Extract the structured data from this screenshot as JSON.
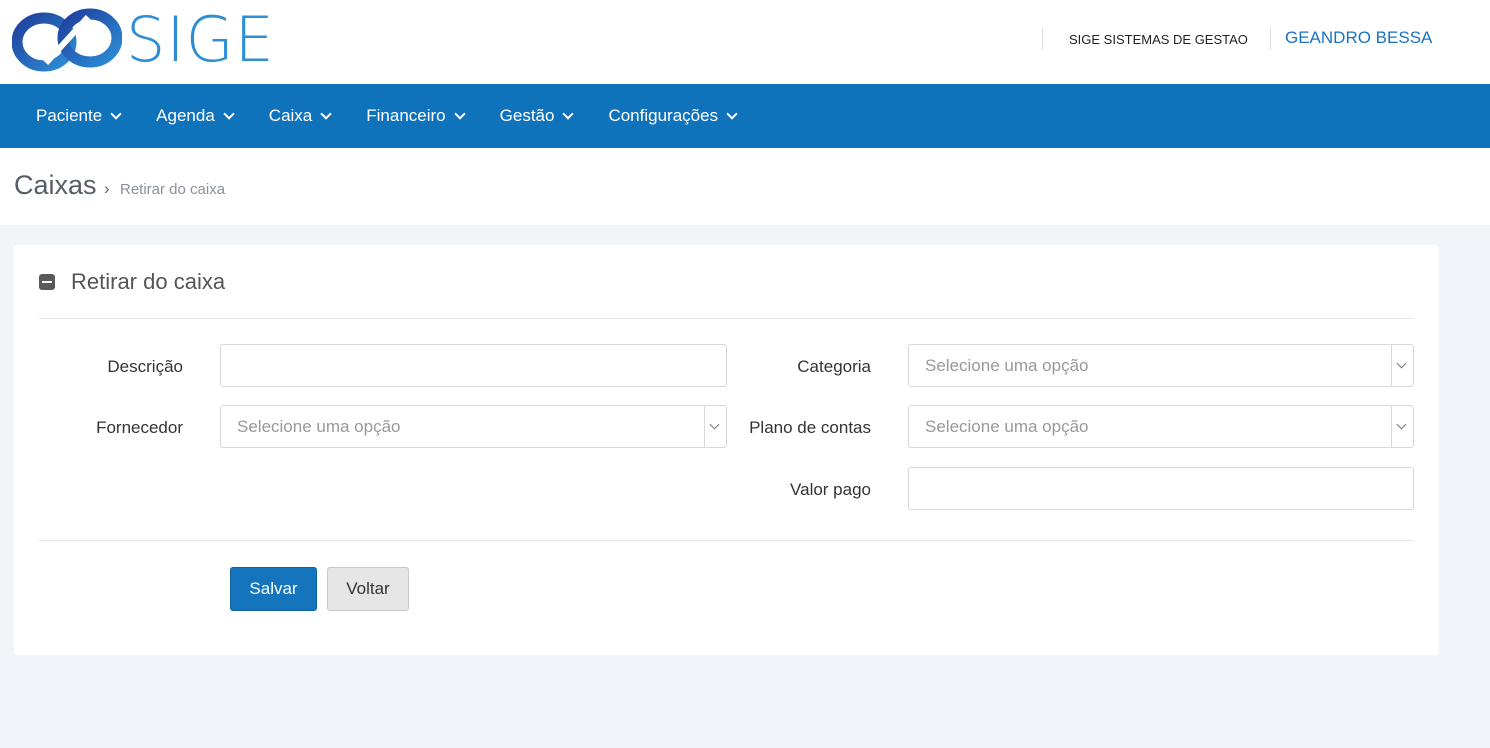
{
  "header": {
    "logo_text": "SIGE",
    "company": "SIGE SISTEMAS DE GESTAO",
    "user": "GEANDRO BESSA"
  },
  "nav": {
    "items": [
      {
        "label": "Paciente"
      },
      {
        "label": "Agenda"
      },
      {
        "label": "Caixa"
      },
      {
        "label": "Financeiro"
      },
      {
        "label": "Gestão"
      },
      {
        "label": "Configurações"
      }
    ]
  },
  "breadcrumb": {
    "title": "Caixas",
    "separator": "›",
    "current": "Retirar do caixa"
  },
  "panel": {
    "title": "Retirar do caixa",
    "fields": {
      "descricao": {
        "label": "Descrição",
        "value": ""
      },
      "categoria": {
        "label": "Categoria",
        "placeholder": "Selecione uma opção"
      },
      "fornecedor": {
        "label": "Fornecedor",
        "placeholder": "Selecione uma opção"
      },
      "plano_contas": {
        "label": "Plano de contas",
        "placeholder": "Selecione uma opção"
      },
      "valor_pago": {
        "label": "Valor pago",
        "value": ""
      }
    },
    "buttons": {
      "save": "Salvar",
      "back": "Voltar"
    }
  },
  "colors": {
    "primary": "#0f73bb",
    "background": "#f1f4f8"
  }
}
